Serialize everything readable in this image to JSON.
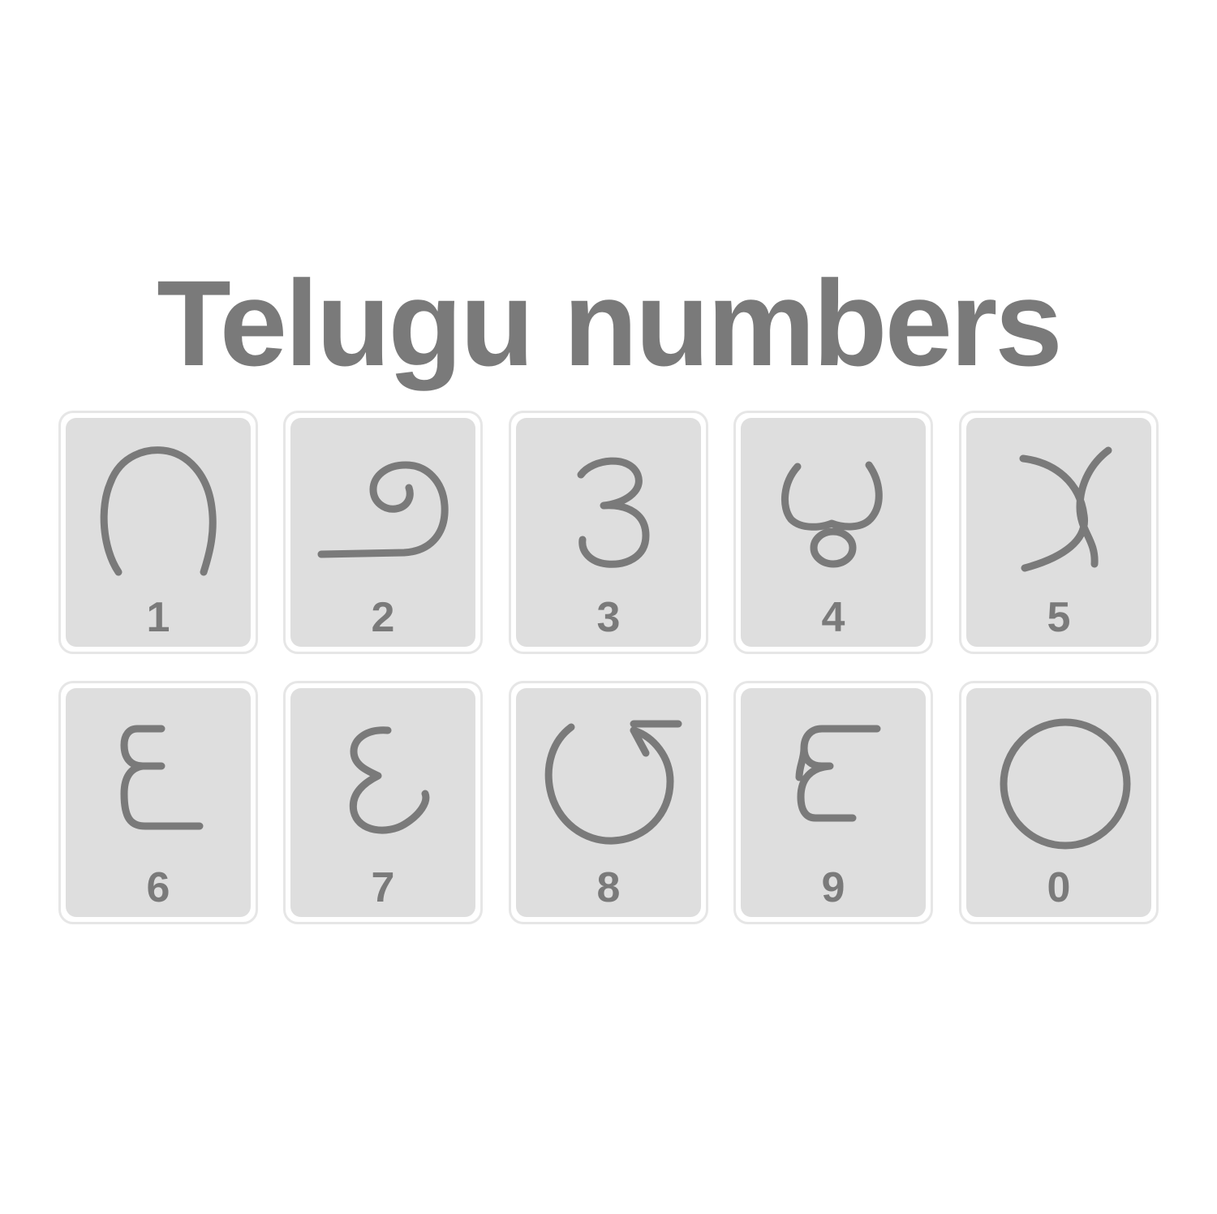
{
  "title": "Telugu numbers",
  "colors": {
    "text": "#7a7a7a",
    "tile_fill": "#dedede",
    "tile_border": "#e6e6e6",
    "background": "#ffffff"
  },
  "tiles": [
    {
      "numeral": "1",
      "glyph": "telugu-digit-one-icon"
    },
    {
      "numeral": "2",
      "glyph": "telugu-digit-two-icon"
    },
    {
      "numeral": "3",
      "glyph": "telugu-digit-three-icon"
    },
    {
      "numeral": "4",
      "glyph": "telugu-digit-four-icon"
    },
    {
      "numeral": "5",
      "glyph": "telugu-digit-five-icon"
    },
    {
      "numeral": "6",
      "glyph": "telugu-digit-six-icon"
    },
    {
      "numeral": "7",
      "glyph": "telugu-digit-seven-icon"
    },
    {
      "numeral": "8",
      "glyph": "telugu-digit-eight-icon"
    },
    {
      "numeral": "9",
      "glyph": "telugu-digit-nine-icon"
    },
    {
      "numeral": "0",
      "glyph": "telugu-digit-zero-icon"
    }
  ]
}
